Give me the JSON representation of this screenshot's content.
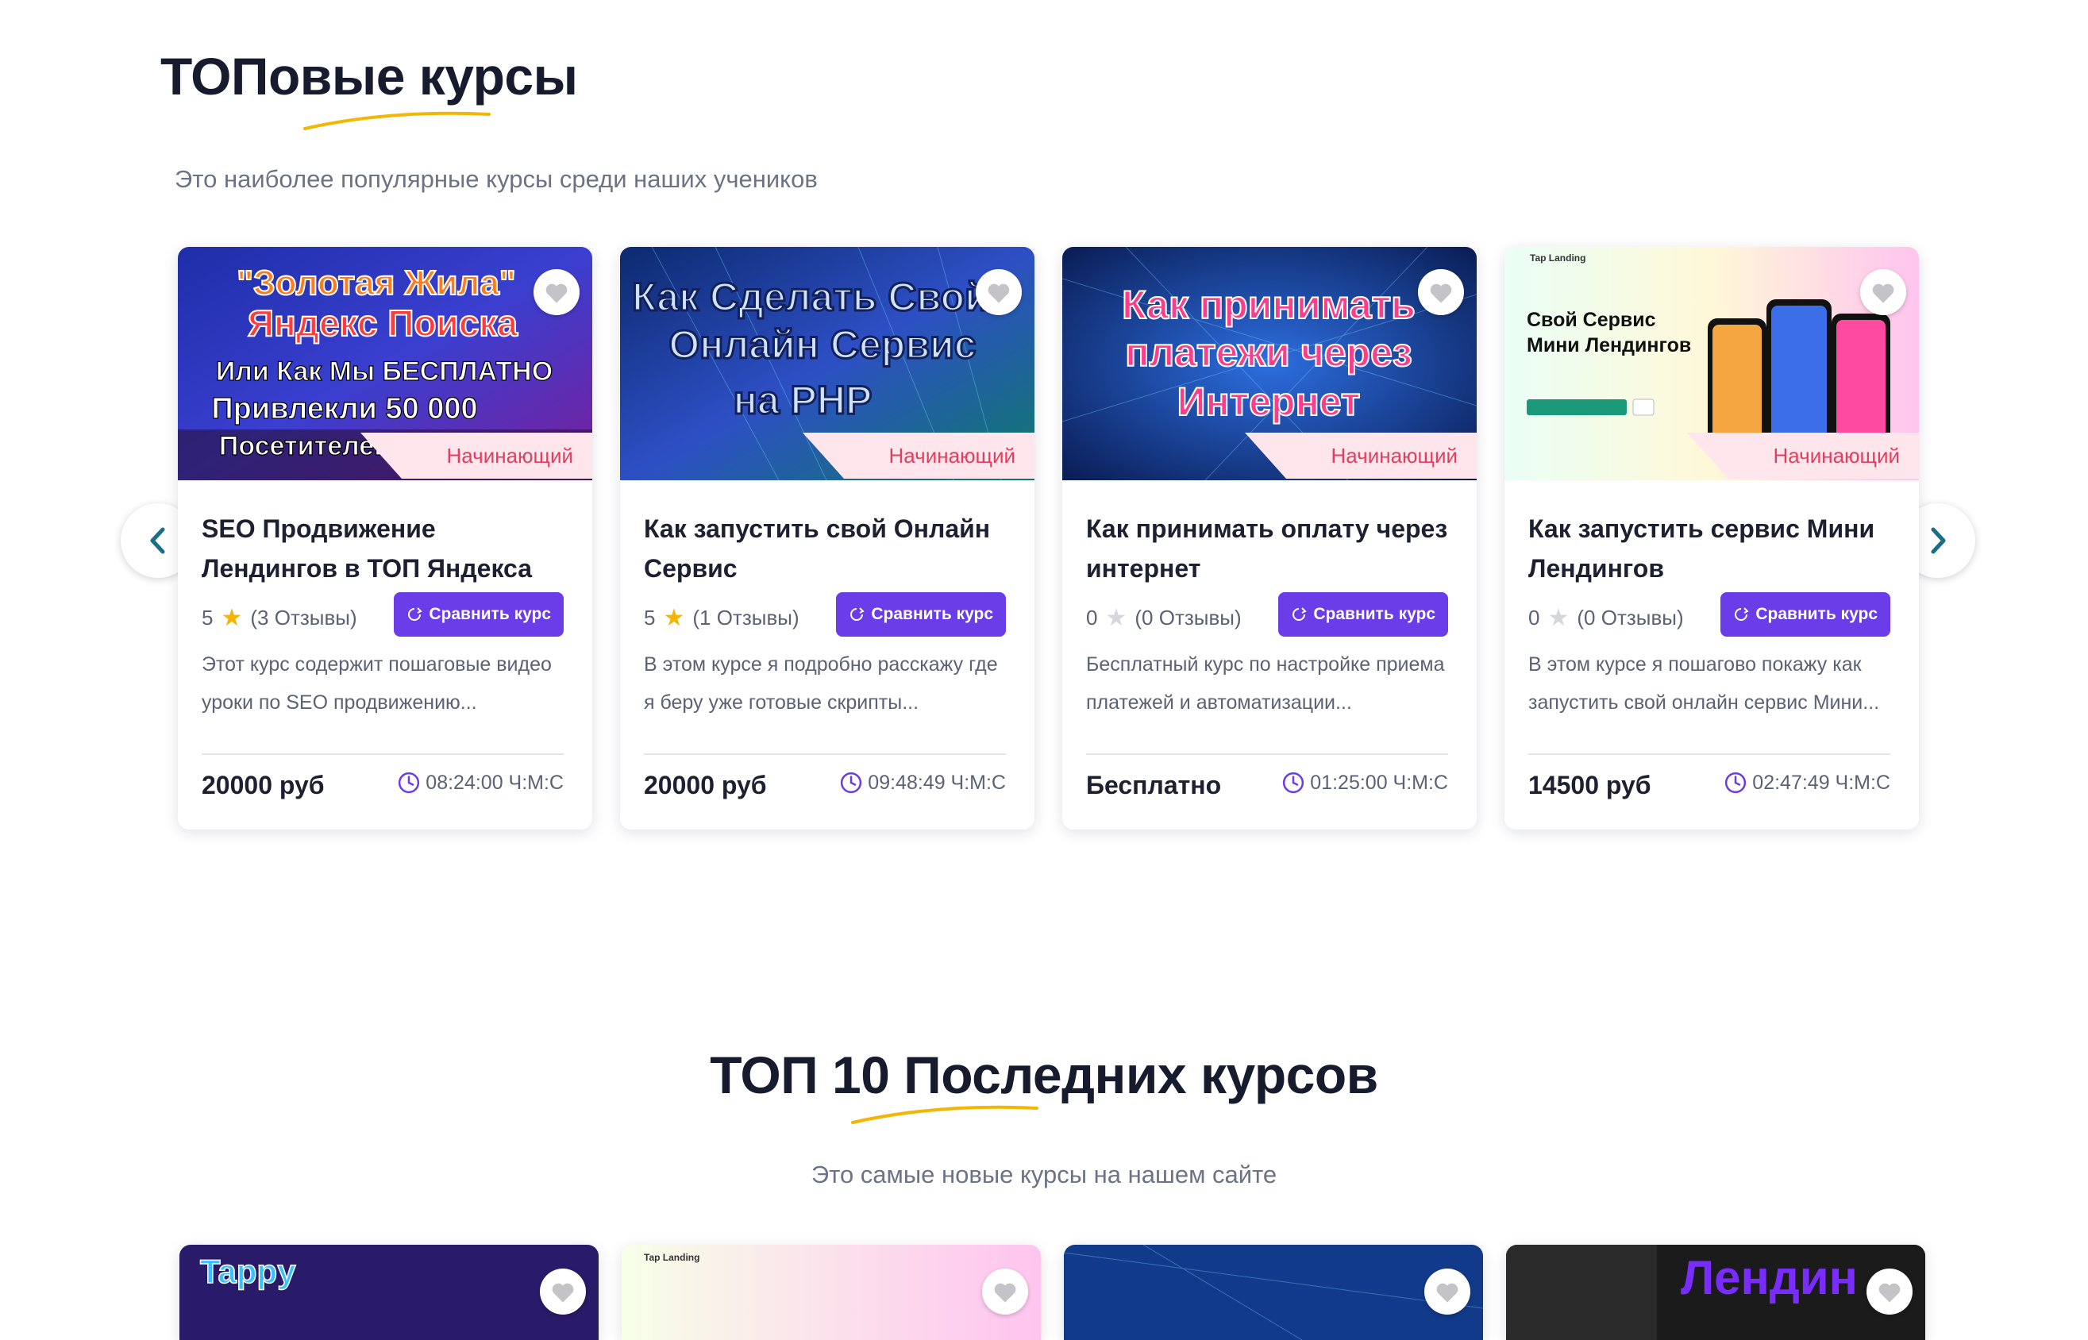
{
  "section1": {
    "title": "ТОПовые курсы",
    "subtitle": "Это наиболее популярные курсы среди наших учеников"
  },
  "section2": {
    "title": "ТОП 10 Последних курсов",
    "subtitle": "Это самые новые курсы на нашем сайте"
  },
  "colors": {
    "accent": "#6a3de8",
    "star": "#f5b400",
    "level_text": "#e0405f",
    "level_bg": "#ffe6ec",
    "underline": "#f2b705",
    "arrow": "#1a6e88"
  },
  "carousel": {
    "prev_icon": "chevron-left-icon",
    "next_icon": "chevron-right-icon"
  },
  "courses": [
    {
      "thumb_lines": [
        "\"Золотая Жила\"",
        "Яндекс Поиска",
        "Или Как Мы БЕСПЛАТНО",
        "Привлекли 50 000",
        "Посетителей"
      ],
      "level": "Начинающий",
      "title": "SEO Продвижение Лендингов в ТОП Яндекса",
      "rating": "5",
      "reviews": "(3 Отзывы)",
      "compare_label": "Сравнить курс",
      "description": "Этот курс содержит пошаговые видео уроки по SEO продвижению...",
      "price": "20000 руб",
      "duration": "08:24:00 Ч:М:С"
    },
    {
      "thumb_lines": [
        "Как Сделать Свой",
        "Онлайн Сервис",
        "на PHP"
      ],
      "level": "Начинающий",
      "title": "Как запустить свой Онлайн Сервис",
      "rating": "5",
      "reviews": "(1 Отзывы)",
      "compare_label": "Сравнить курс",
      "description": "В этом курсе я подробно расскажу где я беру уже готовые скрипты...",
      "price": "20000 руб",
      "duration": "09:48:49 Ч:М:С"
    },
    {
      "thumb_lines": [
        "Как принимать",
        "платежи через",
        "Интернет"
      ],
      "level": "Начинающий",
      "title": "Как принимать оплату через интернет",
      "rating": "0",
      "reviews": "(0 Отзывы)",
      "compare_label": "Сравнить курс",
      "description": "Бесплатный курс по настройке приема платежей и автоматизации...",
      "price": "Бесплатно",
      "duration": "01:25:00 Ч:М:С"
    },
    {
      "thumb_lines": [
        "Свой Сервис",
        "Мини Лендингов"
      ],
      "thumb_brand": "Tap Landing",
      "level": "Начинающий",
      "title": "Как запустить сервис Мини Лендингов",
      "rating": "0",
      "reviews": "(0 Отзывы)",
      "compare_label": "Сравнить курс",
      "description": "В этом курсе я пошагово покажу как запустить свой онлайн сервис Мини...",
      "price": "14500 руб",
      "duration": "02:47:49 Ч:М:С"
    }
  ],
  "latest_thumbs": [
    {
      "thumb_text": "Tappy"
    },
    {
      "thumb_text": "Tap Landing"
    },
    {
      "thumb_text": ""
    },
    {
      "thumb_text": "Лендин"
    }
  ]
}
